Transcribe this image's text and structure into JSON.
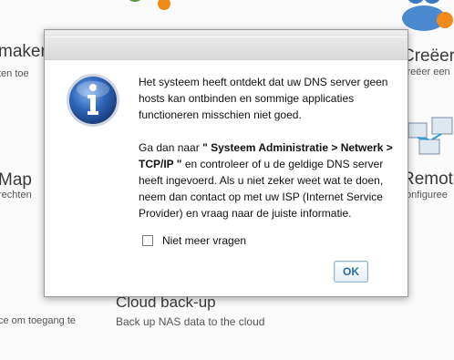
{
  "background": {
    "left_tile_1": {
      "title": "maken",
      "subtitle": "ten toe"
    },
    "left_tile_2": {
      "title": "Map",
      "subtitle": "rechten"
    },
    "left_tile_3": {
      "subtitle": "ce om toegang te"
    },
    "right_tile_1": {
      "title": "Creëer",
      "subtitle": "creëer een"
    },
    "right_tile_2": {
      "title": "Remote",
      "subtitle": "onfiguree"
    },
    "center_tile": {
      "title": "Cloud back-up",
      "subtitle": "Back up NAS data to the cloud"
    }
  },
  "dialog": {
    "message_p1": "Het systeem heeft ontdekt dat uw DNS server geen hosts kan ontbinden en sommige applicaties functioneren misschien niet goed.",
    "message_p2_prefix": "Ga dan naar ",
    "message_p2_bold": "\" Systeem Administratie > Netwerk > TCP/IP \"",
    "message_p2_suffix": " en controleer of u de geldige DNS server heeft ingevoerd. Als u niet zeker weet wat te doen, neem dan contact op met uw ISP (Internet Service Provider) en vraag naar de juiste informatie.",
    "checkbox_label": "Niet meer vragen",
    "checkbox_checked": false,
    "ok_label": "OK"
  },
  "colors": {
    "ok_text": "#1f6fa3",
    "info_icon": "#2d5fa8"
  }
}
